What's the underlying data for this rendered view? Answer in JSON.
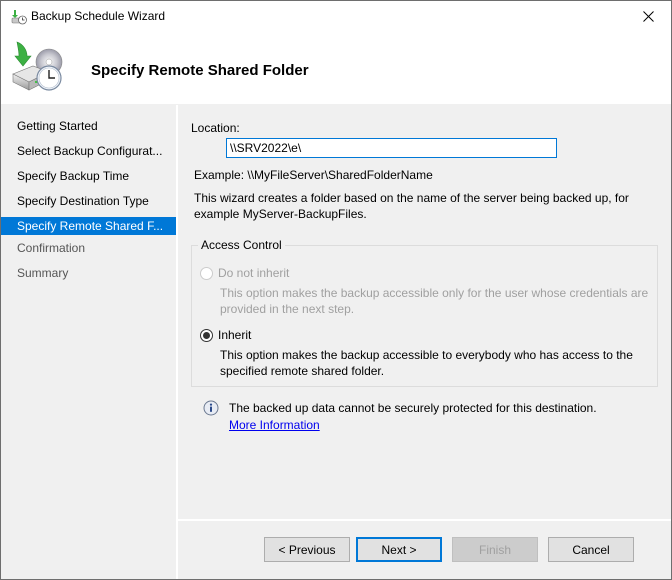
{
  "window": {
    "title": "Backup Schedule Wizard",
    "icons": {
      "app": "backup-schedule-icon",
      "close": "close-icon"
    }
  },
  "header": {
    "title": "Specify Remote Shared Folder",
    "icon": "backup-disk-clock-icon"
  },
  "sidebar": {
    "items": [
      {
        "label": "Getting Started",
        "state": "done"
      },
      {
        "label": "Select Backup Configurat...",
        "state": "done"
      },
      {
        "label": "Specify Backup Time",
        "state": "done"
      },
      {
        "label": "Specify Destination Type",
        "state": "done"
      },
      {
        "label": "Specify Remote Shared F...",
        "state": "active"
      },
      {
        "label": "Confirmation",
        "state": "pending"
      },
      {
        "label": "Summary",
        "state": "pending"
      }
    ],
    "active_color": "#0078d7"
  },
  "main": {
    "location_label": "Location:",
    "location_value": "\\\\SRV2022\\e\\",
    "example": "Example: \\\\MyFileServer\\SharedFolderName",
    "description_line1": "This wizard creates a folder based on the name of the server being backed up, for",
    "description_line2": "example MyServer-BackupFiles.",
    "access_control": {
      "legend": "Access Control",
      "options": [
        {
          "label": "Do not inherit",
          "checked": false,
          "enabled": false,
          "desc_line1": "This option makes the backup accessible only for the user whose credentials are",
          "desc_line2": "provided in the next step."
        },
        {
          "label": "Inherit",
          "checked": true,
          "enabled": true,
          "desc_line1": "This option makes the backup accessible to everybody who has access to the",
          "desc_line2": "specified remote shared folder."
        }
      ]
    },
    "info": {
      "icon": "info-icon",
      "text": "The backed up data cannot be securely protected for this destination.",
      "link": "More Information"
    }
  },
  "footer": {
    "previous": "< Previous",
    "next": "Next >",
    "finish": "Finish",
    "cancel": "Cancel"
  }
}
